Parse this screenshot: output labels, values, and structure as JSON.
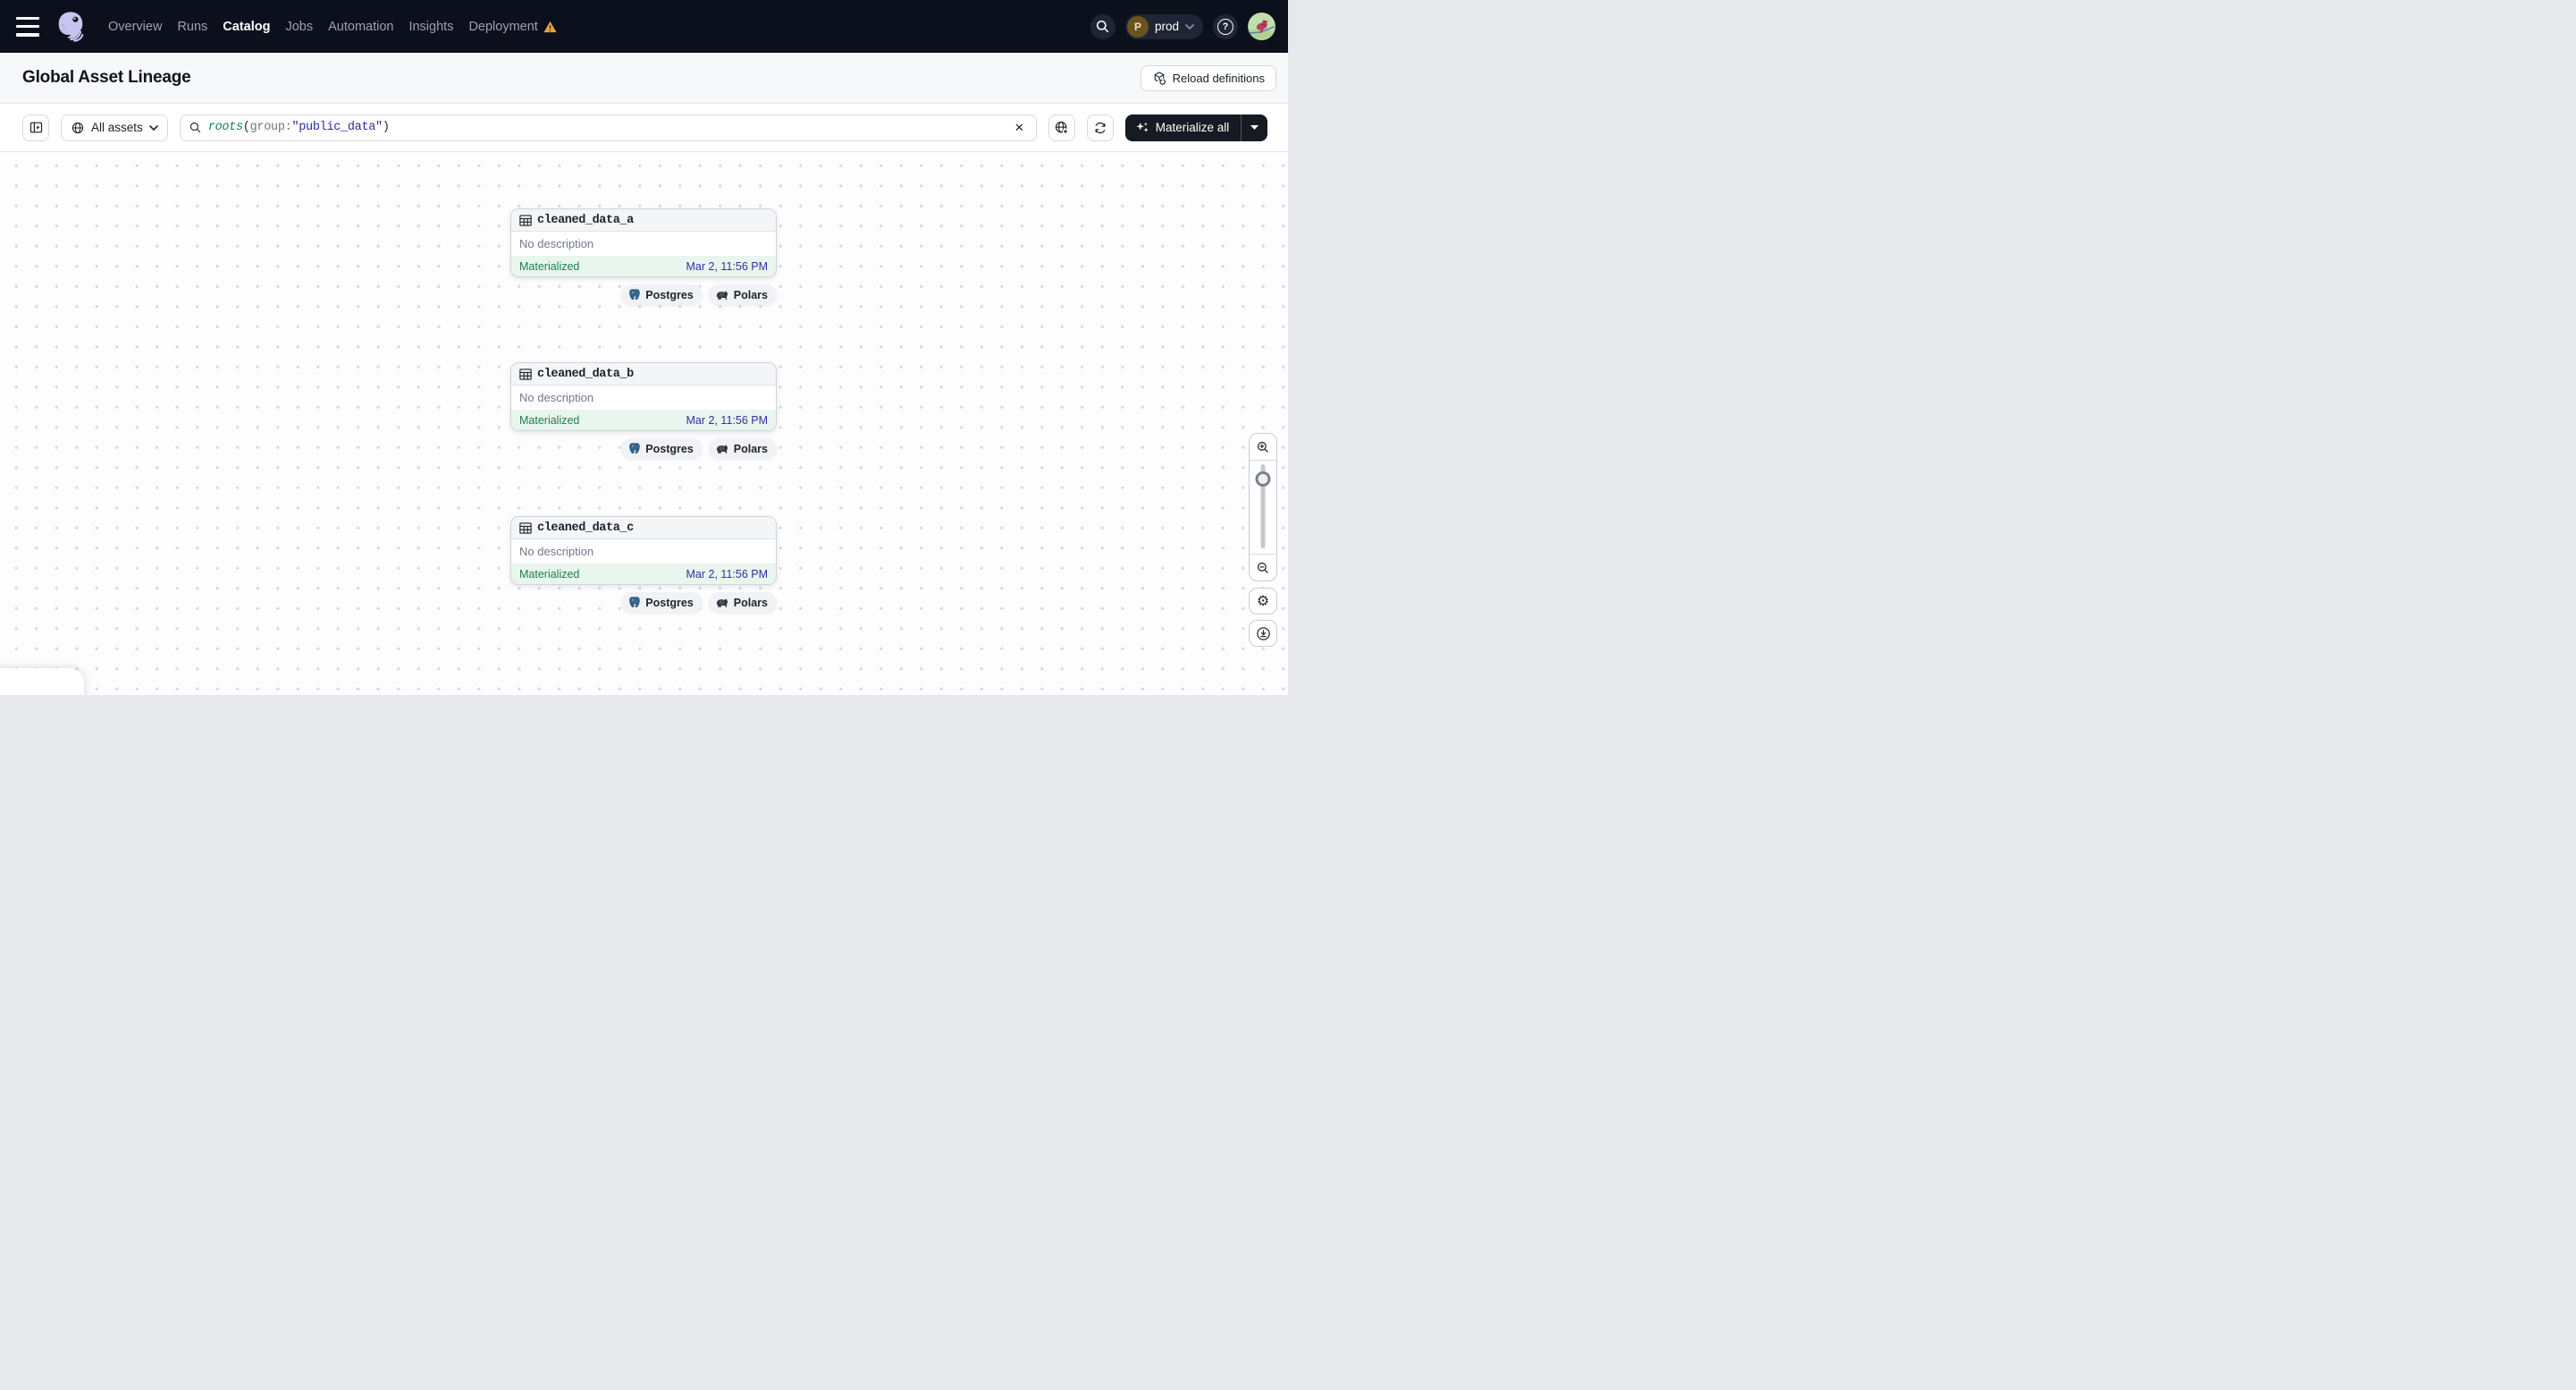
{
  "navbar": {
    "items": [
      {
        "label": "Overview",
        "active": false
      },
      {
        "label": "Runs",
        "active": false
      },
      {
        "label": "Catalog",
        "active": true
      },
      {
        "label": "Jobs",
        "active": false
      },
      {
        "label": "Automation",
        "active": false
      },
      {
        "label": "Insights",
        "active": false
      },
      {
        "label": "Deployment",
        "active": false,
        "warning": true
      }
    ],
    "environment": {
      "initial": "P",
      "name": "prod"
    }
  },
  "header": {
    "title": "Global Asset Lineage",
    "reload_button": "Reload definitions"
  },
  "toolbar": {
    "filter_button": "All assets",
    "search_query": {
      "fn": "roots",
      "open_paren": "(",
      "key": "group",
      "colon": ":",
      "value": "\"public_data\"",
      "close_paren": ")"
    },
    "materialize_button": "Materialize all"
  },
  "graph": {
    "nodes": [
      {
        "name": "cleaned_data_a",
        "description": "No description",
        "status": "Materialized",
        "materialized_at": "Mar 2, 11:56 PM",
        "tags": [
          "Postgres",
          "Polars"
        ]
      },
      {
        "name": "cleaned_data_b",
        "description": "No description",
        "status": "Materialized",
        "materialized_at": "Mar 2, 11:56 PM",
        "tags": [
          "Postgres",
          "Polars"
        ]
      },
      {
        "name": "cleaned_data_c",
        "description": "No description",
        "status": "Materialized",
        "materialized_at": "Mar 2, 11:56 PM",
        "tags": [
          "Postgres",
          "Polars"
        ]
      }
    ]
  },
  "icons": {
    "close_glyph": "✕",
    "help_glyph": "?",
    "gear_glyph": "⚙"
  },
  "colors": {
    "navbar_bg": "#0C101D",
    "warning_orange": "#ECA33D",
    "status_green": "#1E7F4B",
    "timestamp_indigo": "#32309E",
    "footer_green_bg": "#E8F6EE",
    "materialize_bg": "#151A23",
    "query_fn_teal": "#0E7E63",
    "query_value_indigo": "#2B2BA0"
  }
}
